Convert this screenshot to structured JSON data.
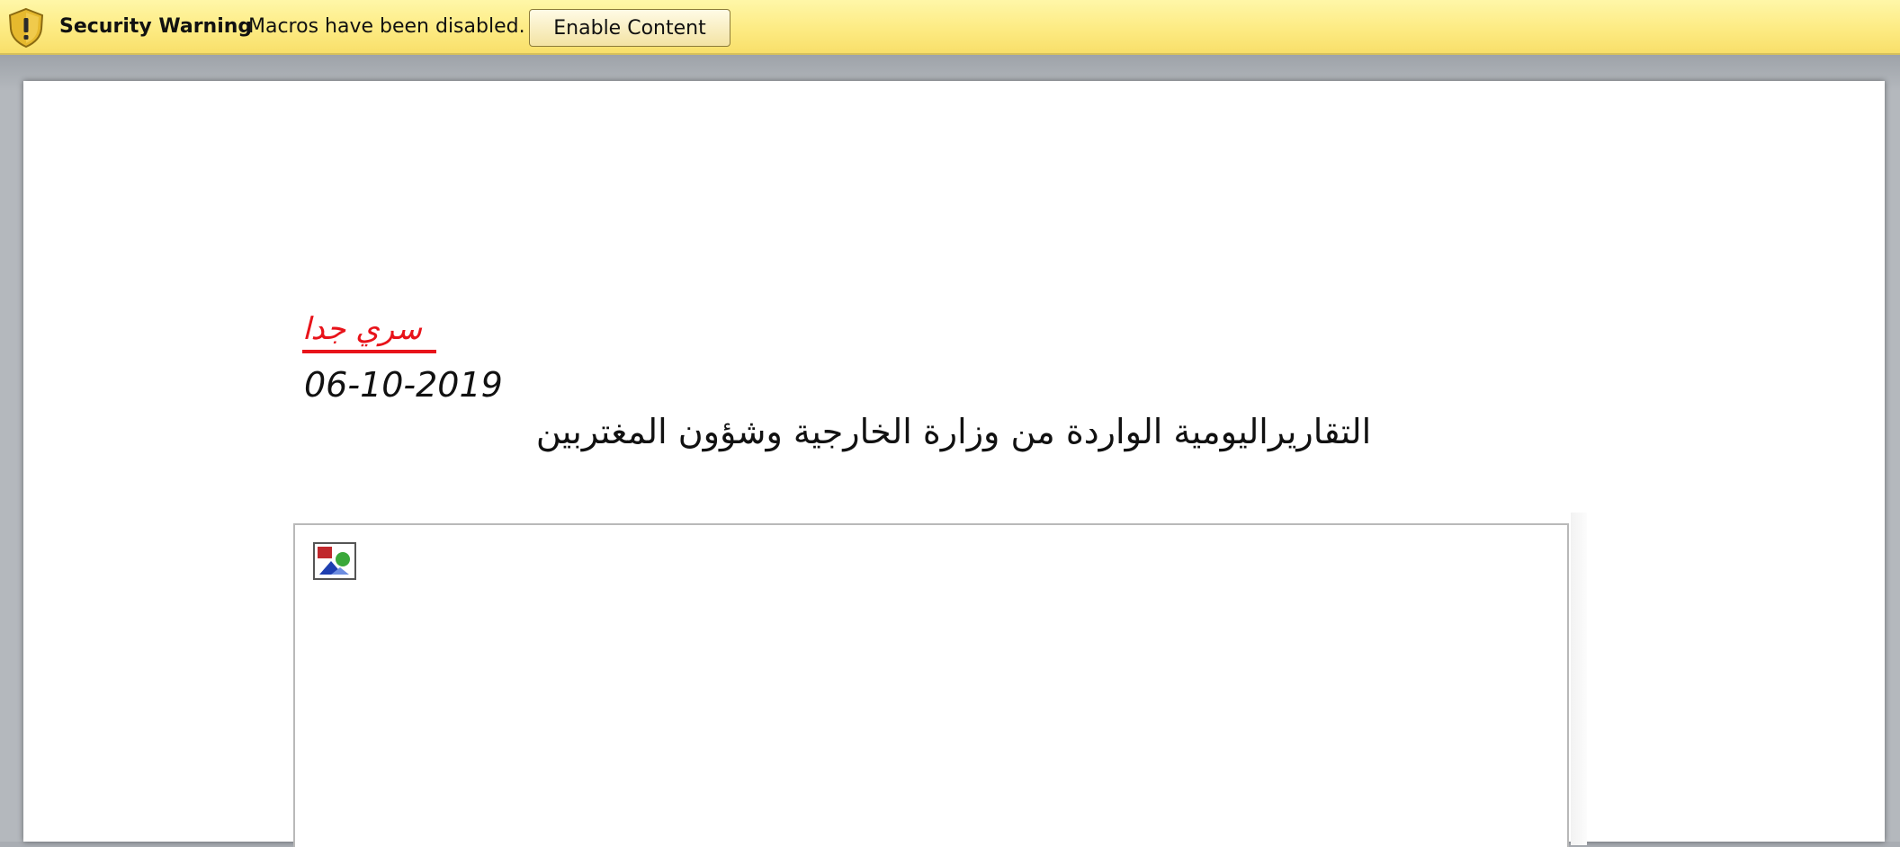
{
  "message_bar": {
    "title": "Security Warning",
    "message": "Macros have been disabled.",
    "enable_button_label": "Enable Content",
    "icon": "shield-warning-icon"
  },
  "document": {
    "classification": "سري جدا",
    "date": "06-10-2019",
    "title": "التقاريراليومية الواردة من وزارة الخارجية وشؤون المغتربين",
    "embedded_image_icon": "broken-image-icon"
  },
  "colors": {
    "message_bar": "#fdeb83",
    "classification_red": "#e8131a",
    "workspace_gray": "#b4b8bd"
  }
}
